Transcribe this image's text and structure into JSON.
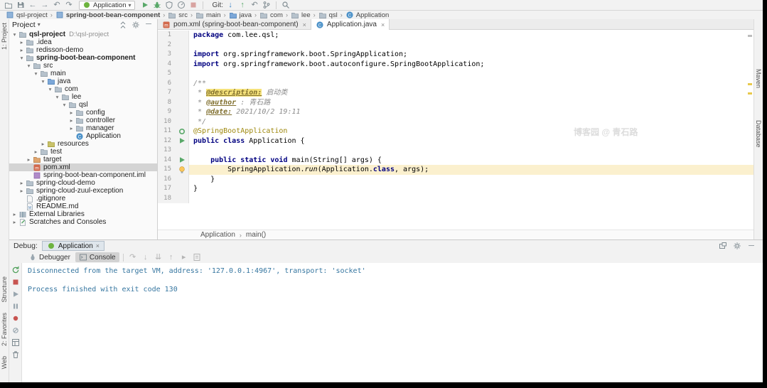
{
  "colors": {
    "toolbar_bg": "#f2f2f2",
    "editor_bg": "#ffffff",
    "keyword": "#000080",
    "annotation": "#9E880D",
    "doc_comment": "#8C8C8C",
    "doc_tag": "#806F2E",
    "doc_tag_highlight_bg": "#F5E27B",
    "highlighted_line_bg": "#FBF0CE",
    "console_system_text": "#3676A0",
    "selection_inactive_bg": "#D4D4D4",
    "run_green": "#59A869",
    "stop_red": "#C75450"
  },
  "toolbar": {
    "left_icons": [
      "open",
      "save",
      "back",
      "forward",
      "undo",
      "redo"
    ],
    "run_config": {
      "icon": "spring-app",
      "label": "Application"
    },
    "run_icons": [
      "run",
      "debug",
      "coverage",
      "profiler",
      "stop"
    ],
    "git_label": "Git:",
    "git_icons": [
      "git-update",
      "git-push",
      "git-rollback",
      "git-branch"
    ],
    "search_icon": "search"
  },
  "breadcrumbs_top": [
    {
      "label": "qsl-project",
      "icon": "module"
    },
    {
      "label": "spring-boot-bean-component",
      "icon": "module",
      "bold": true
    },
    {
      "label": "src",
      "icon": "folder"
    },
    {
      "label": "main",
      "icon": "folder"
    },
    {
      "label": "java",
      "icon": "folder-src"
    },
    {
      "label": "com",
      "icon": "folder"
    },
    {
      "label": "lee",
      "icon": "folder"
    },
    {
      "label": "qsl",
      "icon": "folder"
    },
    {
      "label": "Application",
      "icon": "class"
    }
  ],
  "project_panel": {
    "title": "Project",
    "header_icons": [
      "collapse-all",
      "gear",
      "hide"
    ],
    "tree": [
      {
        "label": "qsl-project",
        "suffix": "D:\\qsl-project",
        "level": 0,
        "icon": "folder",
        "chevron": "down",
        "bold": true
      },
      {
        "label": ".idea",
        "level": 1,
        "icon": "folder",
        "chevron": "right"
      },
      {
        "label": "redisson-demo",
        "level": 1,
        "icon": "folder",
        "chevron": "right"
      },
      {
        "label": "spring-boot-bean-component",
        "level": 1,
        "icon": "folder",
        "chevron": "down",
        "bold": true
      },
      {
        "label": "src",
        "level": 2,
        "icon": "folder",
        "chevron": "down"
      },
      {
        "label": "main",
        "level": 3,
        "icon": "folder",
        "chevron": "down"
      },
      {
        "label": "java",
        "level": 4,
        "icon": "folder-src",
        "chevron": "down"
      },
      {
        "label": "com",
        "level": 5,
        "icon": "folder",
        "chevron": "down"
      },
      {
        "label": "lee",
        "level": 6,
        "icon": "folder",
        "chevron": "down"
      },
      {
        "label": "qsl",
        "level": 7,
        "icon": "folder",
        "chevron": "down"
      },
      {
        "label": "config",
        "level": 8,
        "icon": "folder",
        "chevron": "right"
      },
      {
        "label": "controller",
        "level": 8,
        "icon": "folder",
        "chevron": "right"
      },
      {
        "label": "manager",
        "level": 8,
        "icon": "folder",
        "chevron": "right"
      },
      {
        "label": "Application",
        "level": 8,
        "icon": "class"
      },
      {
        "label": "resources",
        "level": 4,
        "icon": "folder-res",
        "chevron": "right"
      },
      {
        "label": "test",
        "level": 3,
        "icon": "folder",
        "chevron": "right"
      },
      {
        "label": "target",
        "level": 2,
        "icon": "folder-ex",
        "chevron": "right"
      },
      {
        "label": "pom.xml",
        "level": 2,
        "icon": "maven",
        "selected": true
      },
      {
        "label": "spring-boot-bean-component.iml",
        "level": 2,
        "icon": "iml"
      },
      {
        "label": "spring-cloud-demo",
        "level": 1,
        "icon": "folder",
        "chevron": "right"
      },
      {
        "label": "spring-cloud-zuul-exception",
        "level": 1,
        "icon": "folder",
        "chevron": "right"
      },
      {
        "label": ".gitignore",
        "level": 1,
        "icon": "gitignore"
      },
      {
        "label": "README.md",
        "level": 1,
        "icon": "md"
      },
      {
        "label": "External Libraries",
        "level": 0,
        "icon": "lib",
        "chevron": "right"
      },
      {
        "label": "Scratches and Consoles",
        "level": 0,
        "icon": "scratch",
        "chevron": "right"
      }
    ]
  },
  "editor": {
    "tabs": [
      {
        "label": "pom.xml (spring-boot-bean-component)",
        "icon": "maven",
        "active": false
      },
      {
        "label": "Application.java",
        "icon": "class",
        "active": true
      }
    ],
    "breadcrumb": [
      "Application",
      "main()"
    ],
    "watermark": "博客园 @ 青石路",
    "lines": [
      {
        "n": 1,
        "tokens": [
          [
            "package ",
            "kw"
          ],
          [
            "com.lee.qsl;",
            "pl"
          ]
        ]
      },
      {
        "n": 2,
        "tokens": []
      },
      {
        "n": 3,
        "tokens": [
          [
            "import ",
            "kw"
          ],
          [
            "org.springframework.boot.SpringApplication;",
            "pl"
          ]
        ]
      },
      {
        "n": 4,
        "tokens": [
          [
            "import ",
            "kw"
          ],
          [
            "org.springframework.boot.autoconfigure.SpringBootApplication;",
            "pl"
          ]
        ]
      },
      {
        "n": 5,
        "tokens": []
      },
      {
        "n": 6,
        "tokens": [
          [
            "/**",
            "doc"
          ]
        ]
      },
      {
        "n": 7,
        "tokens": [
          [
            " * ",
            "doc"
          ],
          [
            "@description:",
            "tag-hl"
          ],
          [
            " 启动类",
            "doc-i"
          ]
        ]
      },
      {
        "n": 8,
        "tokens": [
          [
            " * ",
            "doc"
          ],
          [
            "@author",
            "tag"
          ],
          [
            " : ",
            "doc"
          ],
          [
            "青石路",
            "doc-i"
          ]
        ]
      },
      {
        "n": 9,
        "tokens": [
          [
            " * ",
            "doc"
          ],
          [
            "@date:",
            "tag"
          ],
          [
            " 2021/10/2 19:11",
            "doc-i"
          ]
        ]
      },
      {
        "n": 10,
        "tokens": [
          [
            " */",
            "doc"
          ]
        ]
      },
      {
        "n": 11,
        "tokens": [
          [
            "@SpringBootApplication",
            "anno"
          ]
        ],
        "gutter": "bean"
      },
      {
        "n": 12,
        "tokens": [
          [
            "public class ",
            "kw"
          ],
          [
            "Application {",
            "pl"
          ]
        ],
        "gutter": "run"
      },
      {
        "n": 13,
        "tokens": []
      },
      {
        "n": 14,
        "tokens": [
          [
            "    ",
            "pl"
          ],
          [
            "public static void ",
            "kw"
          ],
          [
            "main(String[] args) {",
            "pl"
          ]
        ],
        "gutter": "run"
      },
      {
        "n": 15,
        "tokens": [
          [
            "        SpringApplication.",
            "pl"
          ],
          [
            "run",
            "it"
          ],
          [
            "(Application.",
            "pl"
          ],
          [
            "class",
            "kw"
          ],
          [
            ", args);",
            "pl"
          ]
        ],
        "highlight": true,
        "gutter": "bulb"
      },
      {
        "n": 16,
        "tokens": [
          [
            "    }",
            "pl"
          ]
        ]
      },
      {
        "n": 17,
        "tokens": [
          [
            "}",
            "pl"
          ]
        ]
      },
      {
        "n": 18,
        "tokens": []
      }
    ]
  },
  "debug_panel": {
    "label": "Debug:",
    "session_tab": "Application",
    "header_right_icons": [
      "float",
      "gear",
      "hide"
    ],
    "view_tabs": [
      {
        "label": "Debugger",
        "icon": "debugger-tab",
        "active": false
      },
      {
        "label": "Console",
        "icon": "console-tab",
        "active": true
      }
    ],
    "step_icons": [
      "step-over",
      "step-into",
      "force-step-into",
      "step-out",
      "run-to-cursor",
      "evaluate"
    ],
    "strip_icons": [
      "rerun",
      "stop-red",
      "resume",
      "pause",
      "view-breakpoints",
      "mute-breakpoints",
      "layout",
      "trash"
    ],
    "console_lines": [
      "Disconnected from the target VM, address: '127.0.0.1:4967', transport: 'socket'",
      "",
      "Process finished with exit code 130"
    ]
  },
  "tool_window_bars": {
    "left_top": [
      "1: Project"
    ],
    "left_bottom": [
      "Structure",
      "2: Favorites",
      "Web"
    ],
    "right": [
      "Maven",
      "Database"
    ]
  }
}
